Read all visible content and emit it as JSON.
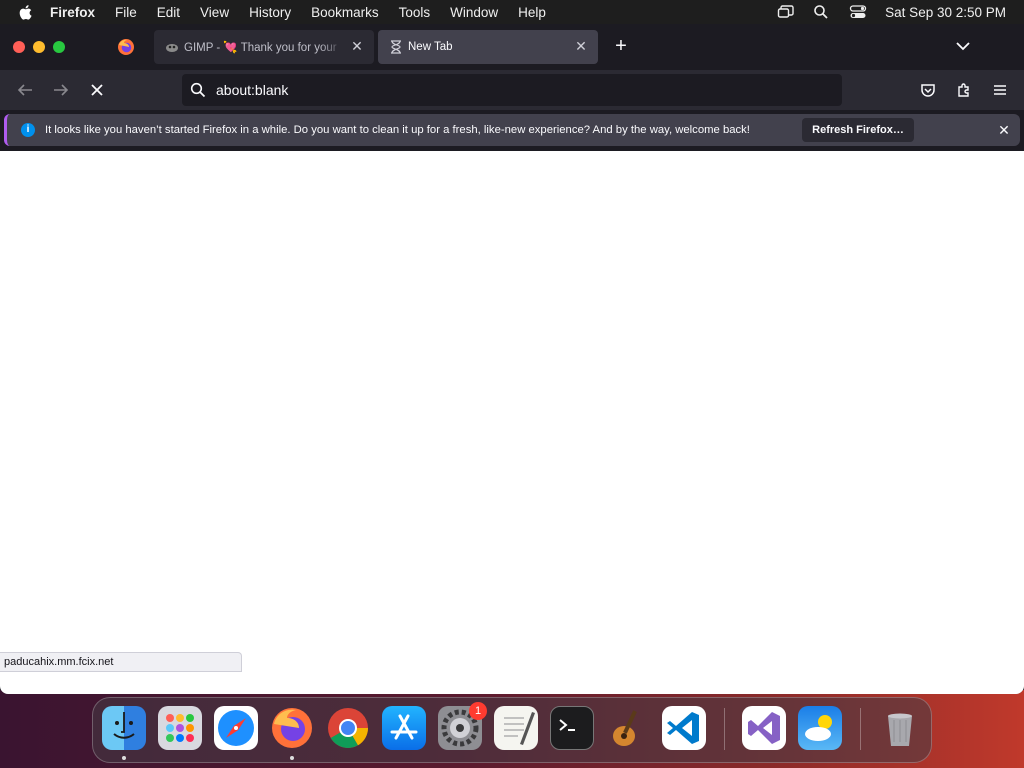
{
  "menubar": {
    "app_name": "Firefox",
    "items": [
      "File",
      "Edit",
      "View",
      "History",
      "Bookmarks",
      "Tools",
      "Window",
      "Help"
    ],
    "clock": "Sat Sep 30  2:50 PM"
  },
  "tabs": [
    {
      "label": "GIMP - 💘 Thank you for your ",
      "favicon": "gimp-icon",
      "active": false
    },
    {
      "label": "New Tab",
      "favicon": "hourglass-icon",
      "active": true
    }
  ],
  "urlbar": {
    "value": "about:blank"
  },
  "notification": {
    "message": "It looks like you haven’t started Firefox in a while. Do you want to clean it up for a fresh, like-new experience? And by the way, welcome back!",
    "button_label": "Refresh Firefox…"
  },
  "status": {
    "url": "paducahix.mm.fcix.net"
  },
  "dock": {
    "items": [
      "Finder",
      "Launchpad",
      "Safari",
      "Firefox",
      "Google Chrome",
      "App Store",
      "System Settings",
      "TextEdit",
      "Terminal",
      "GarageBand",
      "Visual Studio Code",
      "Visual Studio",
      "Weather",
      "Trash"
    ],
    "settings_badge": "1"
  },
  "colors": {
    "accent": "#0090ed",
    "chrome_dark": "#1c1b22",
    "toolbar": "#2b2a33"
  }
}
